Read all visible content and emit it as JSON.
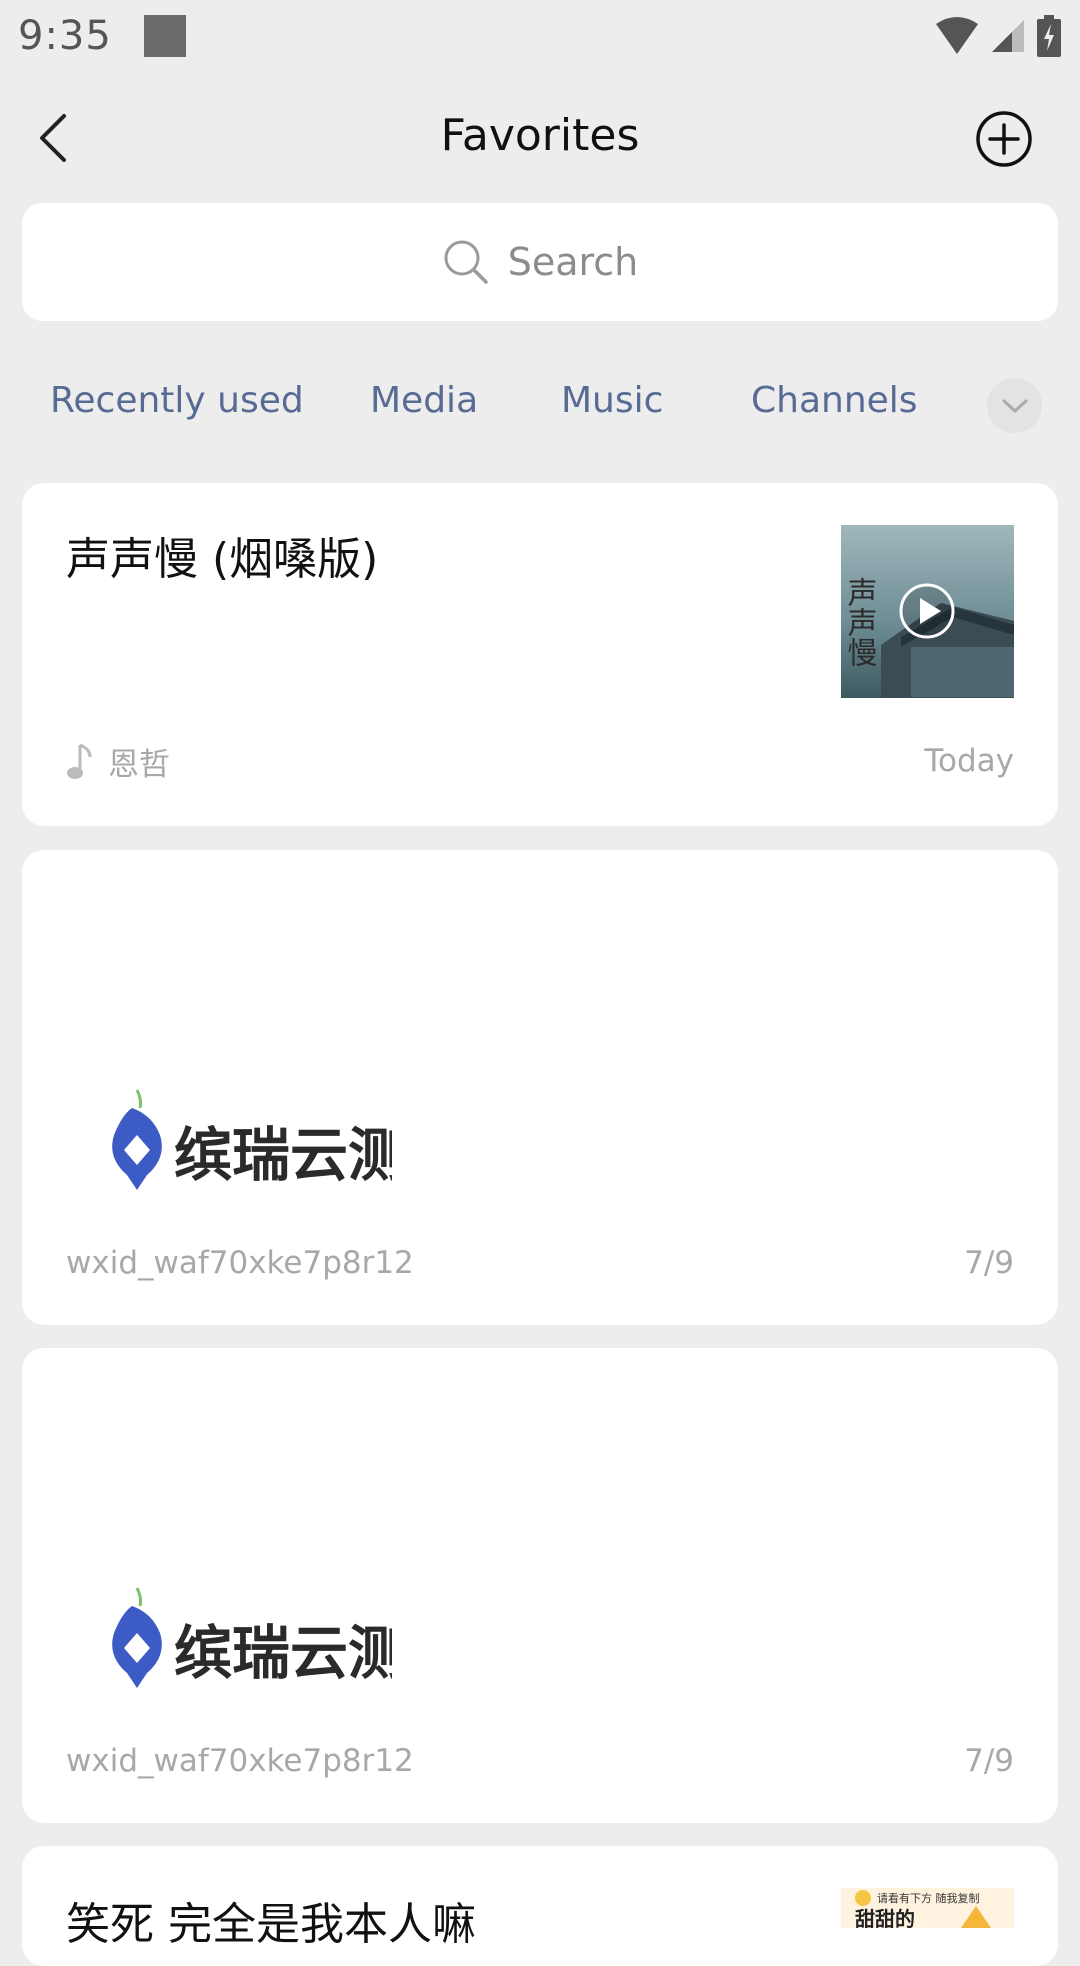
{
  "status_bar": {
    "time": "9:35",
    "icons": [
      "notification-square-icon",
      "wifi-icon",
      "cell-signal-icon",
      "battery-charging-icon"
    ]
  },
  "header": {
    "title": "Favorites",
    "back_icon": "chevron-left-icon",
    "add_icon": "plus-circle-icon"
  },
  "search": {
    "placeholder": "Search",
    "icon": "search-icon"
  },
  "tabs": [
    {
      "label": "Recently used"
    },
    {
      "label": "Media"
    },
    {
      "label": "Music"
    },
    {
      "label": "Channels"
    }
  ],
  "tabs_more_icon": "chevron-down-icon",
  "items": [
    {
      "type": "music",
      "title": "声声慢 (烟嗓版)",
      "thumb_text": "声声慢",
      "meta_icon": "music-note-icon",
      "source": "恩哲",
      "date": "Today"
    },
    {
      "type": "image",
      "logo_text": "缤瑞云测",
      "source": "wxid_waf70xke7p8r12",
      "date": "7/9"
    },
    {
      "type": "image",
      "logo_text": "缤瑞云测",
      "source": "wxid_waf70xke7p8r12",
      "date": "7/9"
    },
    {
      "type": "article",
      "title": "笑死 完全是我本人嘛",
      "thumb_top_text": "请看有下方 随我复制",
      "thumb_text": "甜甜的"
    }
  ],
  "colors": {
    "background": "#ededed",
    "card": "#ffffff",
    "tab_text": "#576b95",
    "muted_text": "#a8a8a8"
  }
}
